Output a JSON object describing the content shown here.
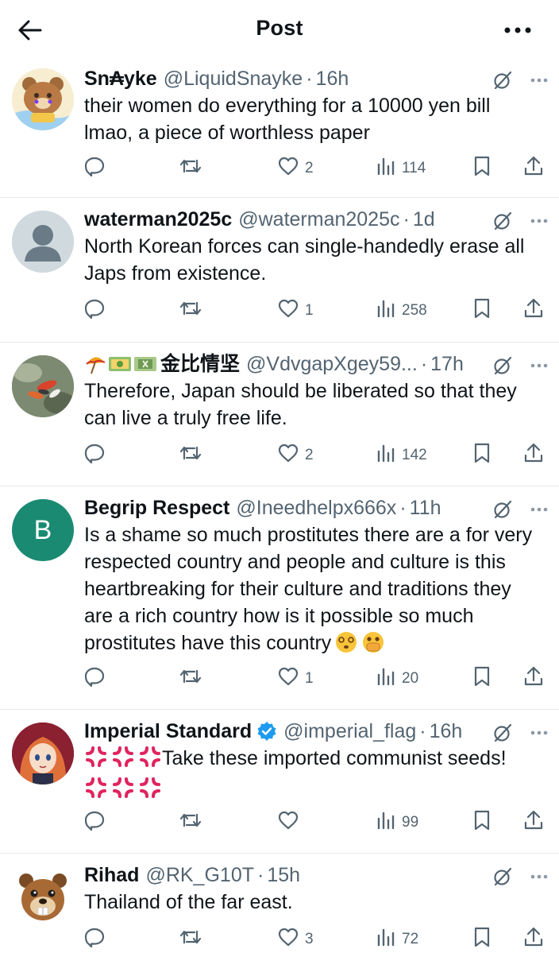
{
  "topbar": {
    "title": "Post"
  },
  "replies": [
    {
      "name": "Sn₳yke",
      "handle": "@LiquidSnayke",
      "time": "16h",
      "text": "their women do everything for a 10000 yen bill lmao, a piece of worthless paper",
      "likes": "2",
      "views": "114",
      "avatar": "bear-cartoon"
    },
    {
      "name": "waterman2025c",
      "handle": "@waterman2025c",
      "time": "1d",
      "text": "North Korean forces can single-handedly erase all Japs from existence.",
      "likes": "1",
      "views": "258",
      "avatar": "default-person"
    },
    {
      "name": "金比情坚",
      "handle": "@VdvgapXgey59...",
      "time": "17h",
      "text": "Therefore, Japan should be liberated so that they can live a truly free life.",
      "likes": "2",
      "views": "142",
      "avatar": "koi-fish-photo"
    },
    {
      "name": "Begrip Respect",
      "handle": "@Ineedhelpx666x",
      "time": "11h",
      "text": "Is a shame so much prostitutes there are a for very respected country and people and culture is this heartbreaking for their culture and traditions they are a rich country how is it possible so much prostitutes have this country",
      "likes": "1",
      "views": "20",
      "avatar": "B"
    },
    {
      "name": "Imperial Standard",
      "handle": "@imperial_flag",
      "time": "16h",
      "text": "Take these imported communist seeds!",
      "likes": "",
      "views": "99",
      "avatar": "anime-girl"
    },
    {
      "name": "Rihad",
      "handle": "@RK_G10T",
      "time": "15h",
      "text": "Thailand of the far east.",
      "likes": "3",
      "views": "72",
      "avatar": "beaver-cartoon"
    }
  ],
  "colors": {
    "text": "#0f1419",
    "muted": "#536471",
    "verified": "#1d9bf0",
    "divider": "#e7e9ea",
    "avatar_b": "#1a8a73"
  }
}
